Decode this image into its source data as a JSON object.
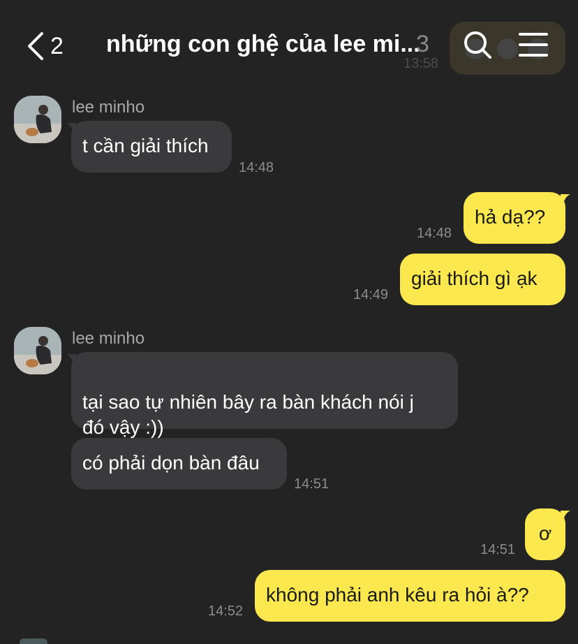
{
  "header": {
    "back_count": "2",
    "title": "những con ghệ của lee mi...",
    "member_count": "3",
    "peek_time": "13:58"
  },
  "messages": [
    {
      "sender": "lee minho",
      "text": "t cần giải thích",
      "time": "14:48"
    },
    {
      "text": "hả dạ??",
      "time": "14:48"
    },
    {
      "text": "giải thích gì ạk",
      "time": "14:49"
    },
    {
      "sender": "lee minho",
      "text": "tại sao tự nhiên bây ra bàn khách nói j\nđó vậy :))"
    },
    {
      "text": "có phải dọn bàn đâu",
      "time": "14:51"
    },
    {
      "text": "ơ",
      "time": "14:51"
    },
    {
      "text": "không phải anh kêu ra hỏi à??",
      "time": "14:52"
    }
  ],
  "colors": {
    "background": "#232323",
    "incoming_bubble": "#3a3a3c",
    "outgoing_bubble": "#fbe84e",
    "timestamp": "#8c8c8c",
    "sender_name": "#a8a8a8"
  },
  "icons": [
    "chevron-left-icon",
    "search-icon",
    "hamburger-menu-icon",
    "avatar"
  ]
}
